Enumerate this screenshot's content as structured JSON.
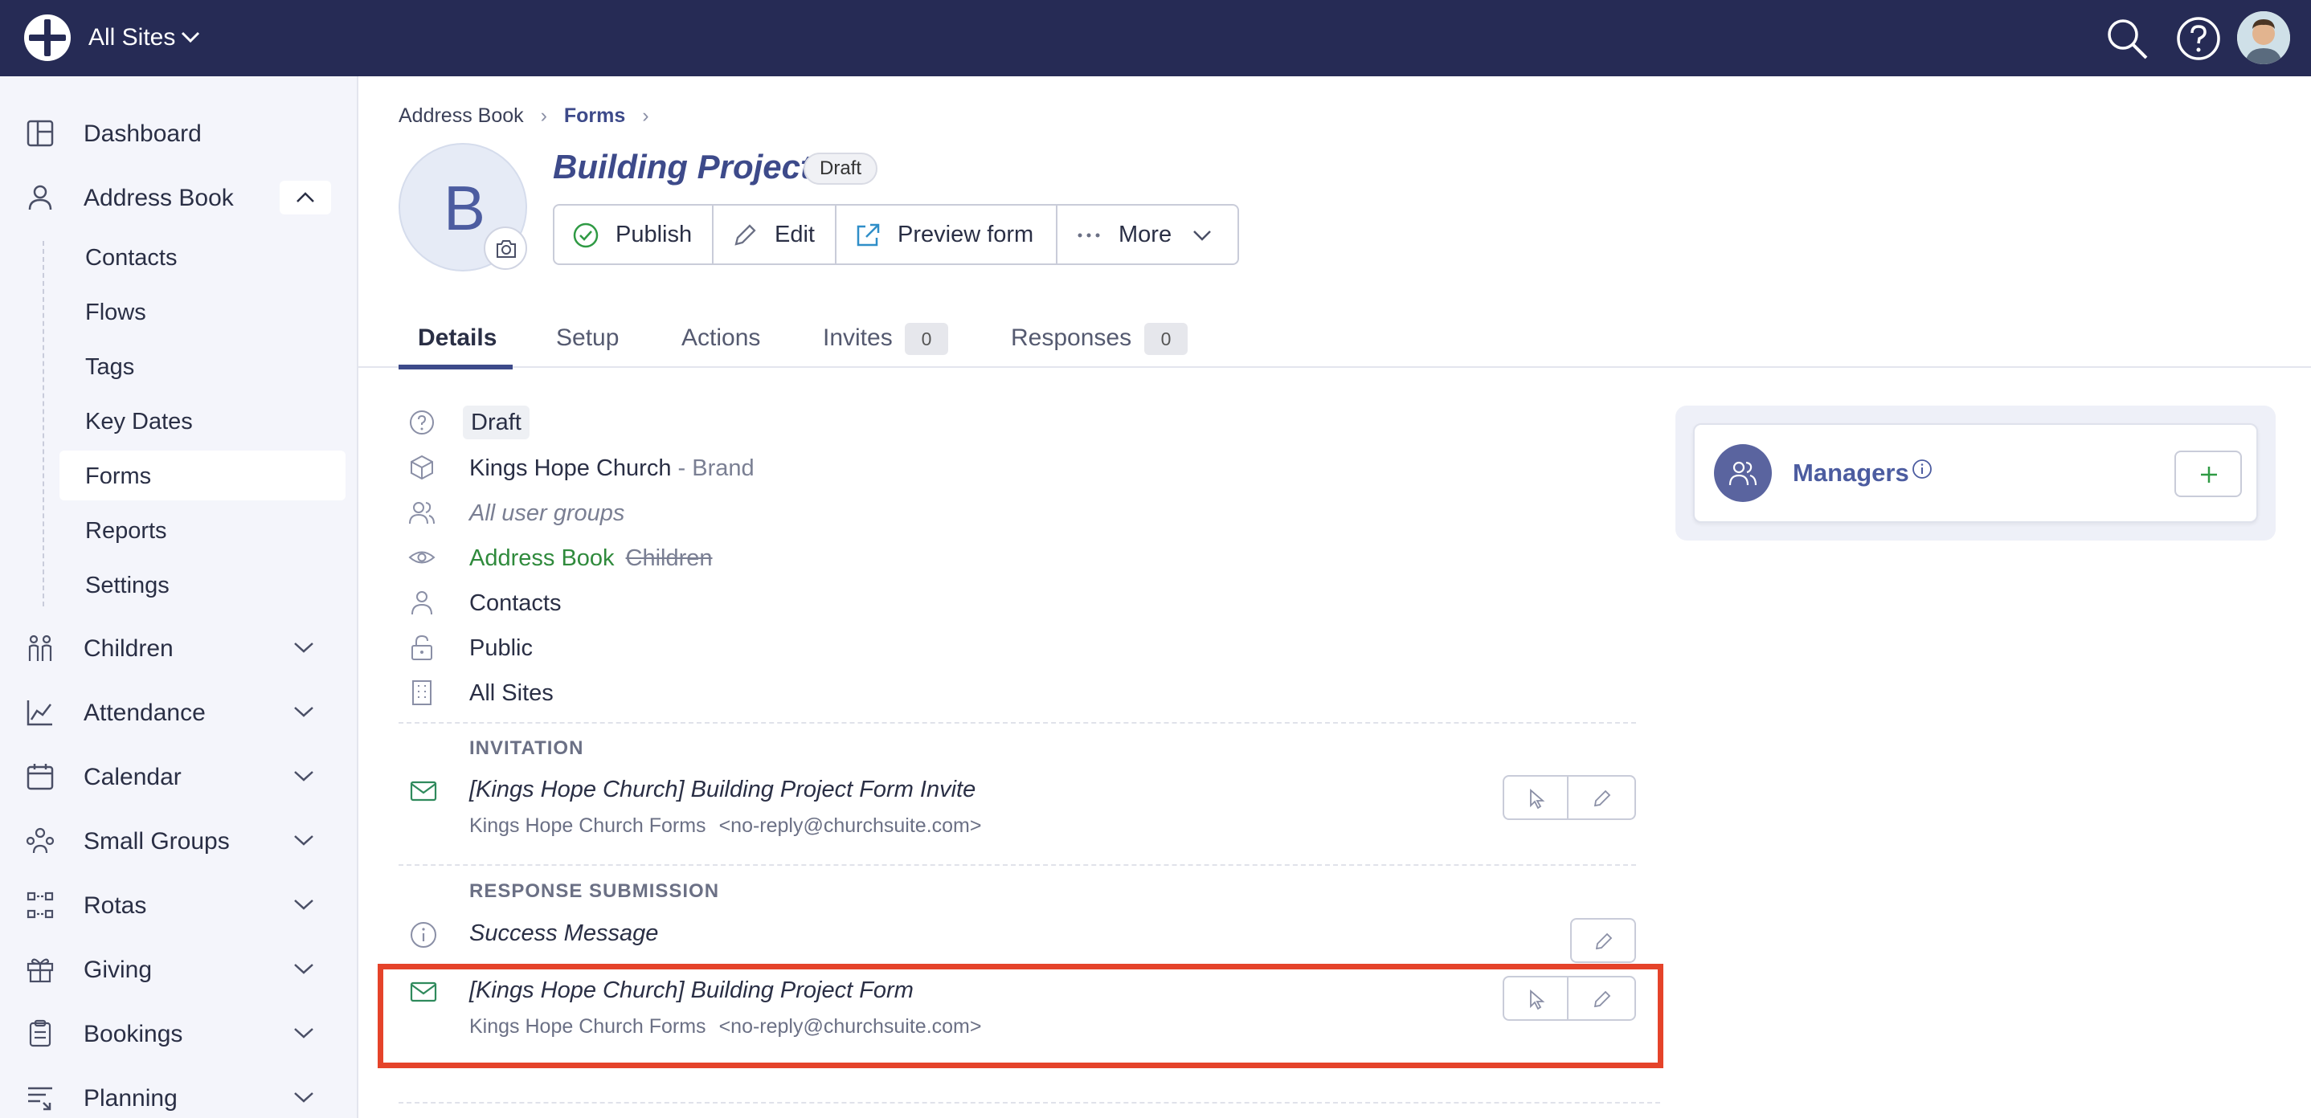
{
  "topbar": {
    "site_label": "All Sites"
  },
  "sidebar": {
    "items": [
      {
        "label": "Dashboard",
        "icon": "dashboard-icon"
      },
      {
        "label": "Address Book",
        "icon": "person-icon",
        "expanded": true
      },
      {
        "label": "Children",
        "icon": "children-icon"
      },
      {
        "label": "Attendance",
        "icon": "chart-icon"
      },
      {
        "label": "Calendar",
        "icon": "calendar-icon"
      },
      {
        "label": "Small Groups",
        "icon": "group-icon"
      },
      {
        "label": "Rotas",
        "icon": "rotas-icon"
      },
      {
        "label": "Giving",
        "icon": "gift-icon"
      },
      {
        "label": "Bookings",
        "icon": "clipboard-icon"
      },
      {
        "label": "Planning",
        "icon": "planning-icon"
      }
    ],
    "sub_items": [
      {
        "label": "Contacts"
      },
      {
        "label": "Flows"
      },
      {
        "label": "Tags"
      },
      {
        "label": "Key Dates"
      },
      {
        "label": "Forms",
        "active": true
      },
      {
        "label": "Reports"
      },
      {
        "label": "Settings"
      }
    ]
  },
  "breadcrumb": {
    "items": [
      "Address Book",
      "Forms"
    ]
  },
  "header": {
    "avatar_letter": "B",
    "title": "Building Project",
    "status": "Draft",
    "buttons": {
      "publish": "Publish",
      "edit": "Edit",
      "preview": "Preview form",
      "more": "More"
    }
  },
  "tabs": [
    {
      "label": "Details",
      "active": true
    },
    {
      "label": "Setup"
    },
    {
      "label": "Actions"
    },
    {
      "label": "Invites",
      "count": "0"
    },
    {
      "label": "Responses",
      "count": "0"
    }
  ],
  "details": {
    "status": "Draft",
    "brand_name": "Kings Hope Church",
    "brand_suffix": "- Brand",
    "user_groups": "All user groups",
    "visibility_active": "Address Book",
    "visibility_inactive": "Children",
    "audience": "Contacts",
    "access": "Public",
    "sites": "All Sites"
  },
  "invitation": {
    "heading": "INVITATION",
    "subject": "[Kings Hope Church] Building Project Form Invite",
    "sender_name": "Kings Hope Church Forms",
    "sender_address": "<no-reply@churchsuite.com>"
  },
  "response_submission": {
    "heading": "RESPONSE SUBMISSION",
    "success_message": "Success Message",
    "subject": "[Kings Hope Church] Building Project Form",
    "sender_name": "Kings Hope Church Forms",
    "sender_address": "<no-reply@churchsuite.com>"
  },
  "managers": {
    "label": "Managers"
  },
  "colors": {
    "topbar": "#262b55",
    "accent": "#3d4a8a",
    "success": "#2f8a3c",
    "highlight": "#e5432a"
  }
}
